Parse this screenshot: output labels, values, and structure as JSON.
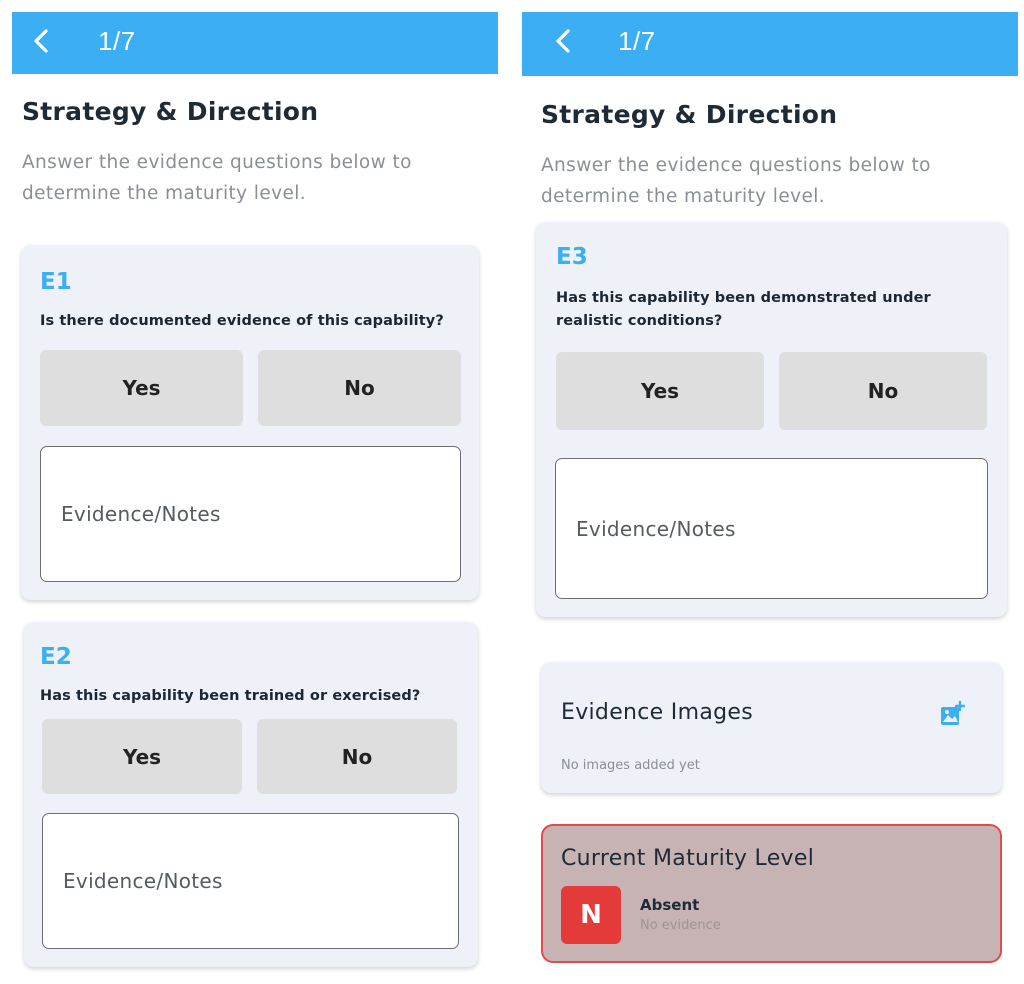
{
  "screens": [
    {
      "header": {
        "page_count": "1/7"
      },
      "title": "Strategy & Direction",
      "subtitle": "Answer the evidence questions below to determine the maturity level.",
      "questions": [
        {
          "label": "E1",
          "text": "Is there documented evidence of this capability?",
          "yes": "Yes",
          "no": "No",
          "notes_placeholder": "Evidence/Notes"
        },
        {
          "label": "E2",
          "text": "Has this capability been trained or exercised?",
          "yes": "Yes",
          "no": "No",
          "notes_placeholder": "Evidence/Notes"
        }
      ]
    },
    {
      "header": {
        "page_count": "1/7"
      },
      "title": "Strategy & Direction",
      "subtitle": "Answer the evidence questions below to determine the maturity level.",
      "questions": [
        {
          "label": "E3",
          "text": "Has this capability been demonstrated under realistic conditions?",
          "yes": "Yes",
          "no": "No",
          "notes_placeholder": "Evidence/Notes"
        }
      ],
      "evidence_images": {
        "title": "Evidence Images",
        "empty_text": "No images added yet"
      },
      "maturity": {
        "title": "Current Maturity Level",
        "badge": "N",
        "level": "Absent",
        "description": "No evidence"
      }
    }
  ],
  "colors": {
    "appbar": "#3caef4",
    "accent": "#3caef4",
    "badge": "#e53a3a",
    "maturity_border": "#e04b4b"
  },
  "icons": {
    "back": "chevron-left-icon",
    "add_image": "add-photo-icon"
  }
}
